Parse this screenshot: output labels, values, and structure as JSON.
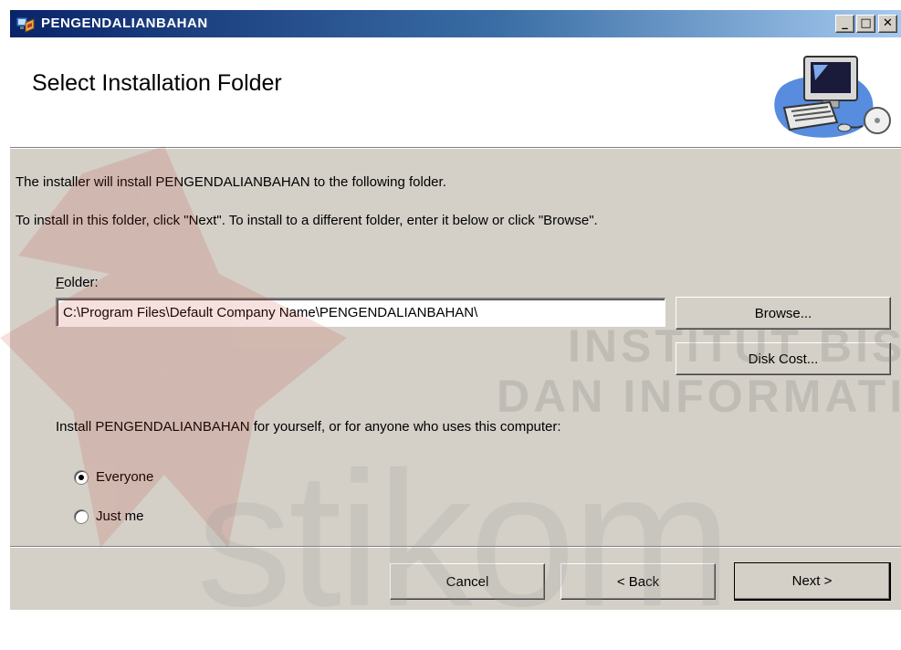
{
  "window": {
    "title": "PENGENDALIANBAHAN",
    "minimize_glyph": "_",
    "maximize_glyph": "□",
    "close_glyph": "✕"
  },
  "banner": {
    "title": "Select Installation Folder",
    "graphic_icon": "computer-setup-icon"
  },
  "body": {
    "description_1": "The installer will install PENGENDALIANBAHAN to the following folder.",
    "description_2": "To install in this folder, click \"Next\". To install to a different folder, enter it below or click \"Browse\".",
    "folder_label_accel": "F",
    "folder_label_rest": "older:",
    "folder_value": "C:\\Program Files\\Default Company Name\\PENGENDALIANBAHAN\\",
    "browse_label": "Browse...",
    "disk_cost_label": "Disk Cost...",
    "install_for_text": "Install PENGENDALIANBAHAN for yourself, or for anyone who uses this computer:",
    "options": [
      {
        "label": "Everyone",
        "selected": true
      },
      {
        "label": "Just me",
        "selected": false
      }
    ]
  },
  "footer": {
    "cancel_label": "Cancel",
    "back_label": "< Back",
    "next_label": "Next >"
  },
  "watermark": {
    "line_1": "INSTITUT BISNIS",
    "line_2": "DAN INFORMATIKA",
    "brand": "stikom"
  },
  "colors": {
    "titlebar_start": "#0a246a",
    "titlebar_end": "#a6caf0",
    "dialog_face": "#d4d0c8",
    "watermark_red": "#c0392b"
  }
}
